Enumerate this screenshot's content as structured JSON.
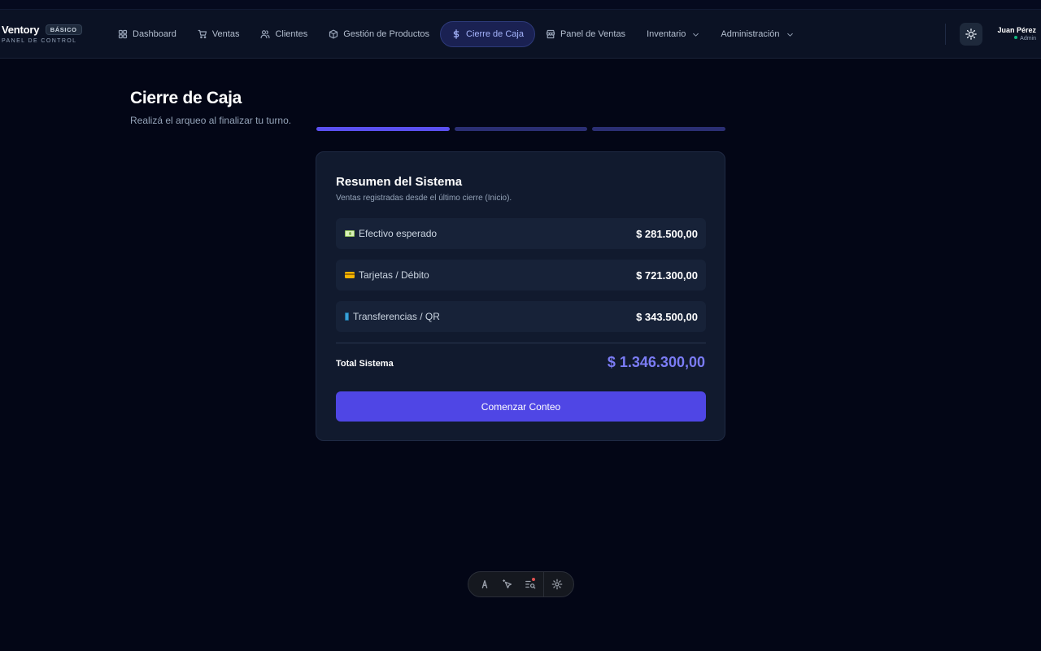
{
  "brand": {
    "name": "Ventory",
    "badge": "BÁSICO",
    "subtitle": "PANEL DE CONTROL"
  },
  "nav": [
    {
      "label": "Dashboard",
      "icon": "dashboard-icon"
    },
    {
      "label": "Ventas",
      "icon": "cart-icon"
    },
    {
      "label": "Clientes",
      "icon": "users-icon"
    },
    {
      "label": "Gestión de Productos",
      "icon": "box-icon"
    },
    {
      "label": "Cierre de Caja",
      "icon": "dollar-icon",
      "active": true
    },
    {
      "label": "Panel de Ventas",
      "icon": "store-icon"
    },
    {
      "label": "Inventario",
      "dropdown": true
    },
    {
      "label": "Administración",
      "dropdown": true
    }
  ],
  "user": {
    "name": "Juan Pérez",
    "role": "Admin",
    "status_color": "#10b981"
  },
  "page": {
    "title": "Cierre de Caja",
    "subtitle": "Realizá el arqueo al finalizar tu turno."
  },
  "stepper": {
    "total_steps": 3,
    "current_step": 1
  },
  "summary": {
    "title": "Resumen del Sistema",
    "subtitle": "Ventas registradas desde el último cierre (Inicio).",
    "rows": [
      {
        "icon": "cash-icon",
        "label": "Efectivo esperado",
        "value": "$ 281.500,00"
      },
      {
        "icon": "card-icon",
        "label": "Tarjetas / Débito",
        "value": "$ 721.300,00"
      },
      {
        "icon": "phone-icon",
        "label": "Transferencias / QR",
        "value": "$ 343.500,00"
      }
    ],
    "total_label": "Total Sistema",
    "total_value": "$ 1.346.300,00",
    "button_label": "Comenzar Conteo"
  },
  "colors": {
    "accent": "#4f46e5",
    "total_text": "#7b7cf5",
    "background": "#030616",
    "card": "#111a2e"
  }
}
